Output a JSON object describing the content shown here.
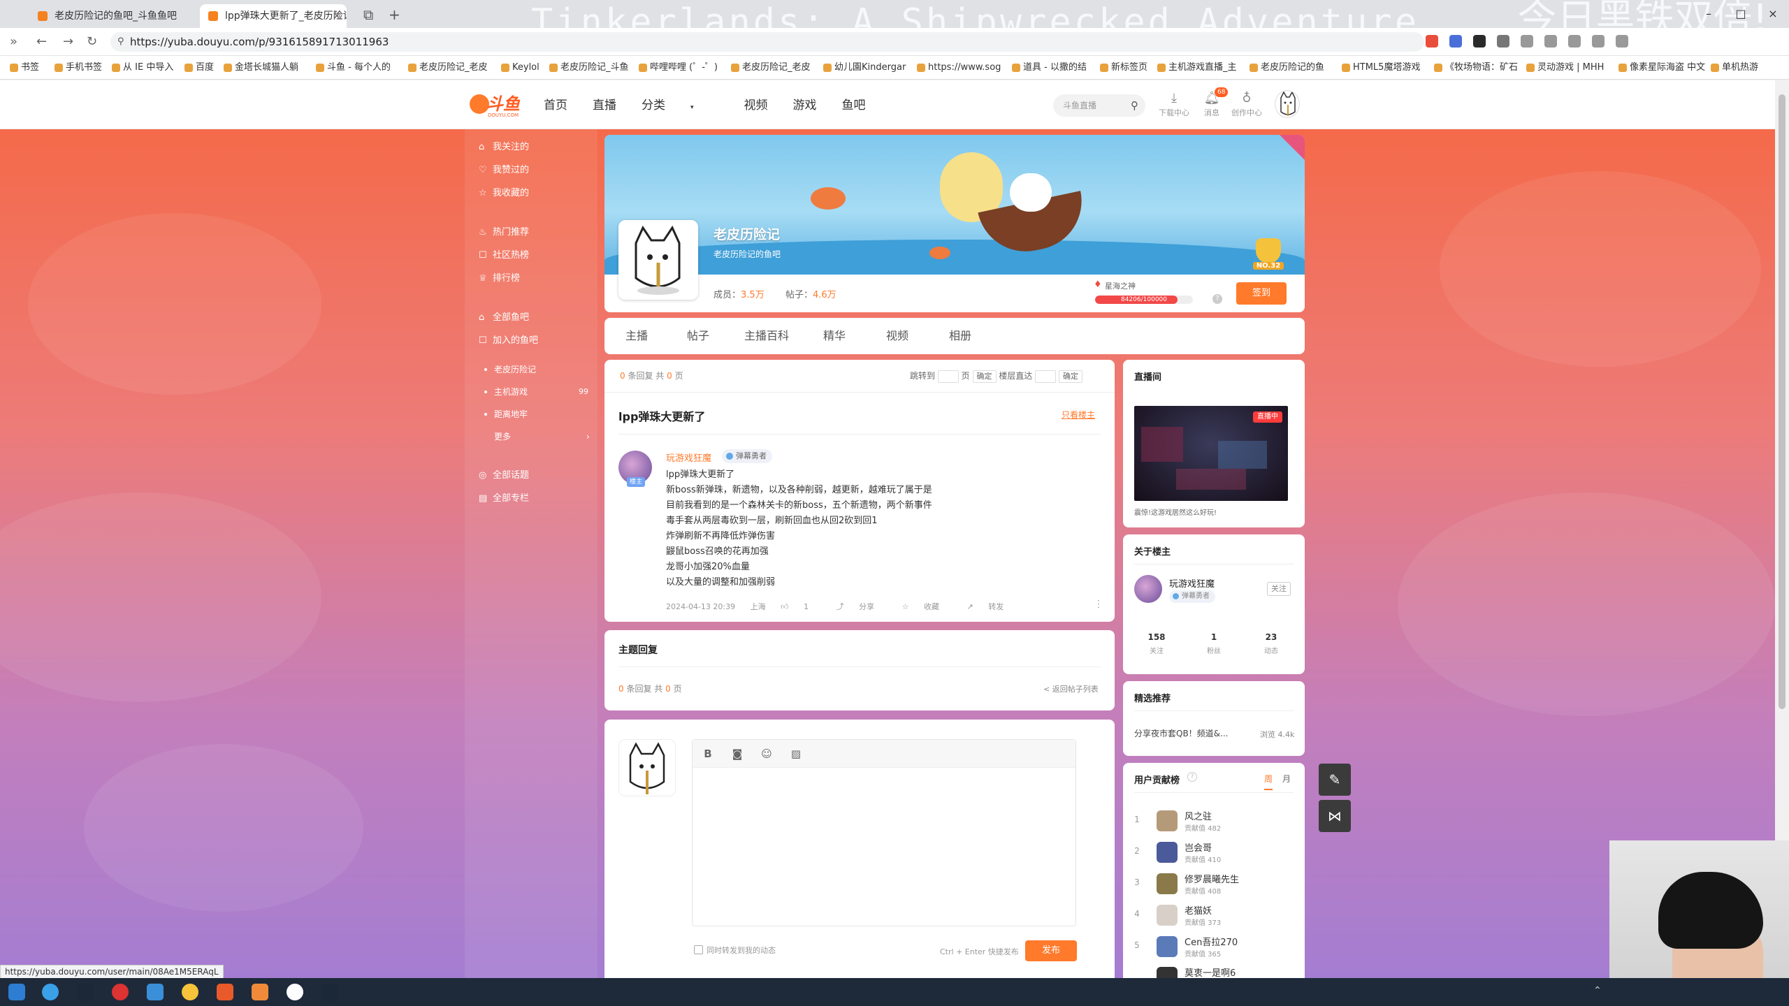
{
  "browser": {
    "tabs": [
      {
        "title": "老皮历险记的鱼吧_斗鱼鱼吧",
        "active": false
      },
      {
        "title": "lpp弹珠大更新了_老皮历险记",
        "active": true
      }
    ],
    "url": "https://yuba.douyu.com/p/931615891713011963",
    "overlay_title": "Tinkerlands: A Shipwrecked Adventure",
    "overlay_title2": "今日黑铁双倍!",
    "bookmarks": [
      "书签",
      "手机书签",
      "从 IE 中导入",
      "百度",
      "金塔长城猫人躺",
      "斗鱼 - 每个人的",
      "老皮历险记_老皮",
      "Keylol",
      "老皮历险记_斗鱼",
      "哔哩哔哩 (゜-゜)",
      "老皮历险记_老皮",
      "幼儿園Kindergar",
      "https://www.sog",
      "道具 - 以撒的结",
      "新标签页",
      "主机游戏直播_主",
      "老皮历险记的鱼",
      "HTML5魔塔游戏",
      "《牧场物语：矿石",
      "灵动游戏 | MHH",
      "像素星际海盗 中文",
      "单机热游"
    ],
    "status_url": "https://yuba.douyu.com/user/main/08Ae1M5ERAqL"
  },
  "site": {
    "logo_text": "斗鱼",
    "logo_sub": "DOUYU.COM",
    "nav": [
      "首页",
      "直播",
      "分类",
      "视频",
      "游戏",
      "鱼吧"
    ],
    "search_placeholder": "斗鱼直播",
    "tools": [
      {
        "label": "下载中心",
        "icon": "download-icon"
      },
      {
        "label": "消息",
        "icon": "bell-icon",
        "badge": "68"
      },
      {
        "label": "创作中心",
        "icon": "bulb-icon"
      }
    ]
  },
  "sidebar": {
    "group1": [
      "我关注的",
      "我赞过的",
      "我收藏的"
    ],
    "group2": [
      "热门推荐",
      "社区热榜",
      "排行榜"
    ],
    "group3": [
      "全部鱼吧",
      "加入的鱼吧"
    ],
    "bars": [
      {
        "name": "老皮历险记",
        "count": ""
      },
      {
        "name": "主机游戏",
        "count": "99"
      },
      {
        "name": "距离地牢",
        "count": ""
      }
    ],
    "more": "更多",
    "group4": [
      "全部话题",
      "全部专栏"
    ]
  },
  "bar": {
    "name": "老皮历险记",
    "desc": "老皮历险记的鱼吧",
    "members_label": "成员：",
    "members": "3.5万",
    "posts_label": "帖子：",
    "posts": "4.6万",
    "rank": "NO.32",
    "level_name": "星海之神",
    "level_progress": 84206,
    "level_max": 100000,
    "level_text": "84206/100000",
    "sign_label": "签到"
  },
  "tabs": [
    "主播",
    "帖子",
    "主播百科",
    "精华",
    "视频",
    "相册"
  ],
  "post": {
    "pager": {
      "pre": "",
      "replies": "0",
      "mid": "条回复 共",
      "pages": "0",
      "post": "页"
    },
    "jump": {
      "label": "跳转到",
      "page": "页",
      "ok": "确定",
      "floor": "楼层直达",
      "ok2": "确定"
    },
    "title": "lpp弹珠大更新了",
    "only_op": "只看楼主",
    "op_tag": "楼主",
    "author": "玩游戏狂魔",
    "author_badge": "弹幕勇者",
    "lines": [
      "lpp弹珠大更新了",
      "新boss新弹珠，新遗物，以及各种削弱，越更新，越难玩了属于是",
      "目前我看到的是一个森林关卡的新boss，五个新遗物，两个新事件",
      "毒手套从两层毒砍到一层，刷新回血也从回2砍到回1",
      "炸弹刷新不再降低炸弹伤害",
      "鼹鼠boss召唤的花再加强",
      "龙哥小加强20%血量",
      "以及大量的调整和加强削弱"
    ],
    "meta": {
      "time": "2024-04-13 20:39",
      "location": "上海",
      "likes": "1",
      "share": "分享",
      "fav": "收藏",
      "forward": "转发"
    }
  },
  "replies": {
    "title": "主题回复",
    "count": "0",
    "mid": "条回复 共",
    "pages": "0",
    "post": "页",
    "back": "< 返回帖子列表"
  },
  "editor": {
    "sync_label": "同时转发到我的动态",
    "hint": "Ctrl + Enter 快捷发布",
    "publish": "发布"
  },
  "live": {
    "title": "直播间",
    "tag": "直播中",
    "caption": "震惊!这游戏居然这么好玩!"
  },
  "anchor": {
    "title": "关于楼主",
    "name": "玩游戏狂魔",
    "badge": "弹幕勇者",
    "follow": "关注",
    "stats": [
      {
        "value": "158",
        "label": "关注"
      },
      {
        "value": "1",
        "label": "粉丝"
      },
      {
        "value": "23",
        "label": "动态"
      }
    ]
  },
  "featured": {
    "title": "精选推荐",
    "item": "分享夜市套QB！频道&...",
    "views": "浏览 4.4k"
  },
  "contrib": {
    "title": "用户贡献榜",
    "periods": [
      "周",
      "月"
    ],
    "rows": [
      {
        "rank": "1",
        "name": "风之驻",
        "value": "贡献值 482"
      },
      {
        "rank": "2",
        "name": "岂会哥",
        "value": "贡献值 410"
      },
      {
        "rank": "3",
        "name": "修罗晨曦先生",
        "value": "贡献值 408"
      },
      {
        "rank": "4",
        "name": "老猫妖",
        "value": "贡献值 373"
      },
      {
        "rank": "5",
        "name": "Cen吾拉270",
        "value": "贡献值 365"
      },
      {
        "rank": "6",
        "name": "莫衷一是啊6",
        "value": ""
      }
    ]
  }
}
